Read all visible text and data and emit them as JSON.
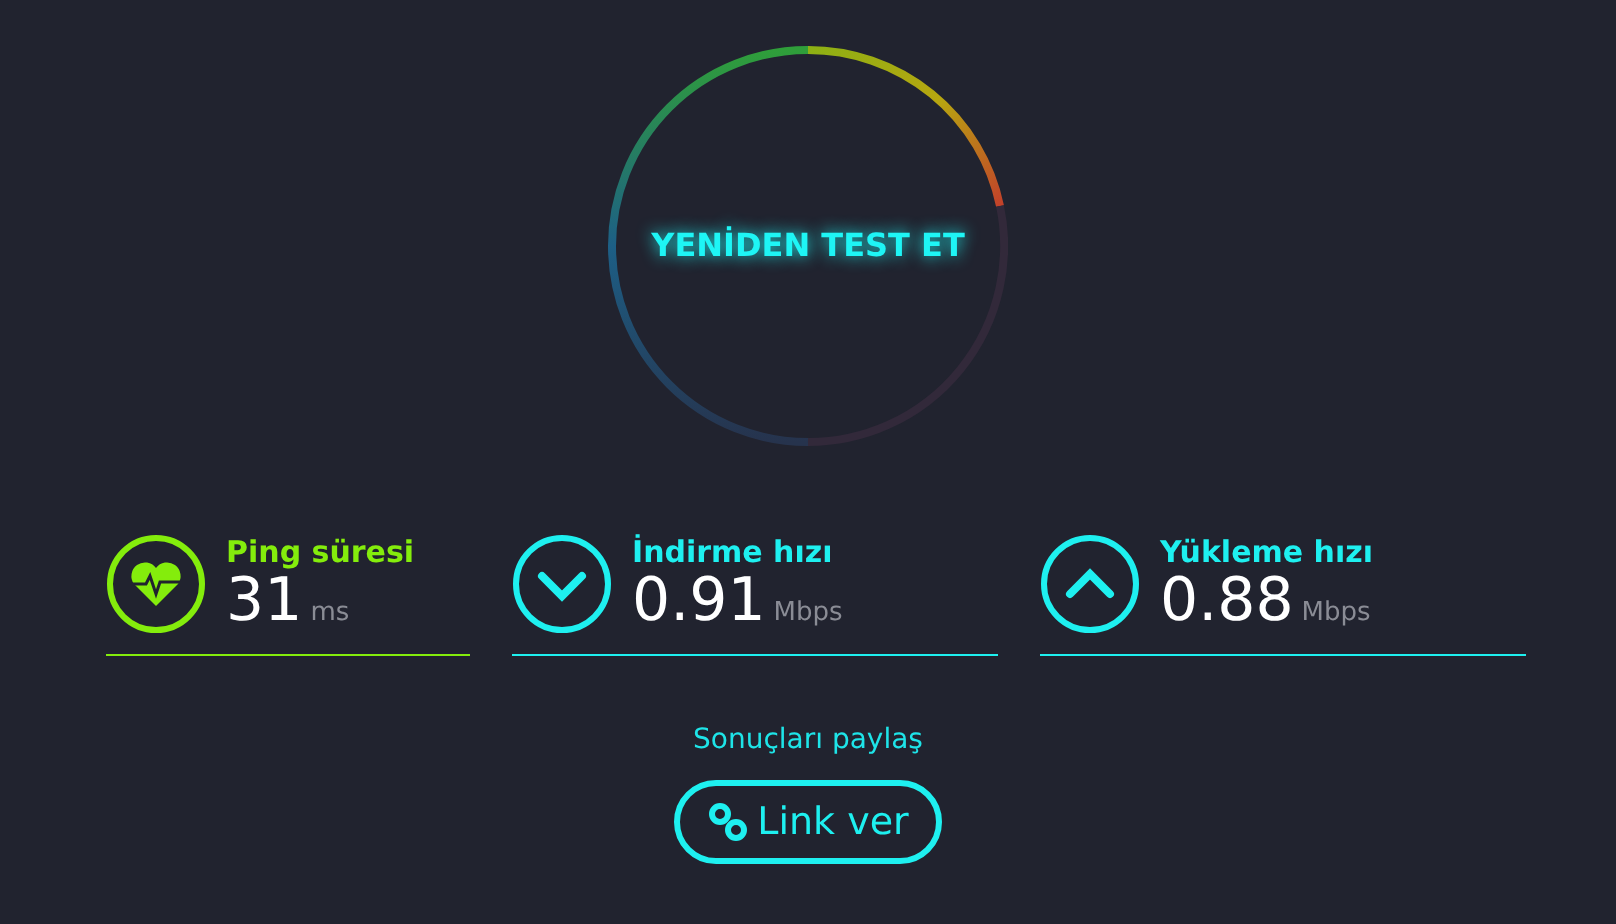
{
  "gauge": {
    "button": "YENİDEN TEST ET"
  },
  "metrics": [
    {
      "kind": "ping",
      "label": "Ping süresi",
      "value": "31",
      "unit": "ms",
      "color": "#84ed0c"
    },
    {
      "kind": "download",
      "label": "İndirme hızı",
      "value": "0.91",
      "unit": "Mbps",
      "color": "#1ef0f0"
    },
    {
      "kind": "upload",
      "label": "Yükleme hızı",
      "value": "0.88",
      "unit": "Mbps",
      "color": "#1ef0f0"
    }
  ],
  "share": {
    "label": "Sonuçları paylaş",
    "button": "Link ver"
  }
}
